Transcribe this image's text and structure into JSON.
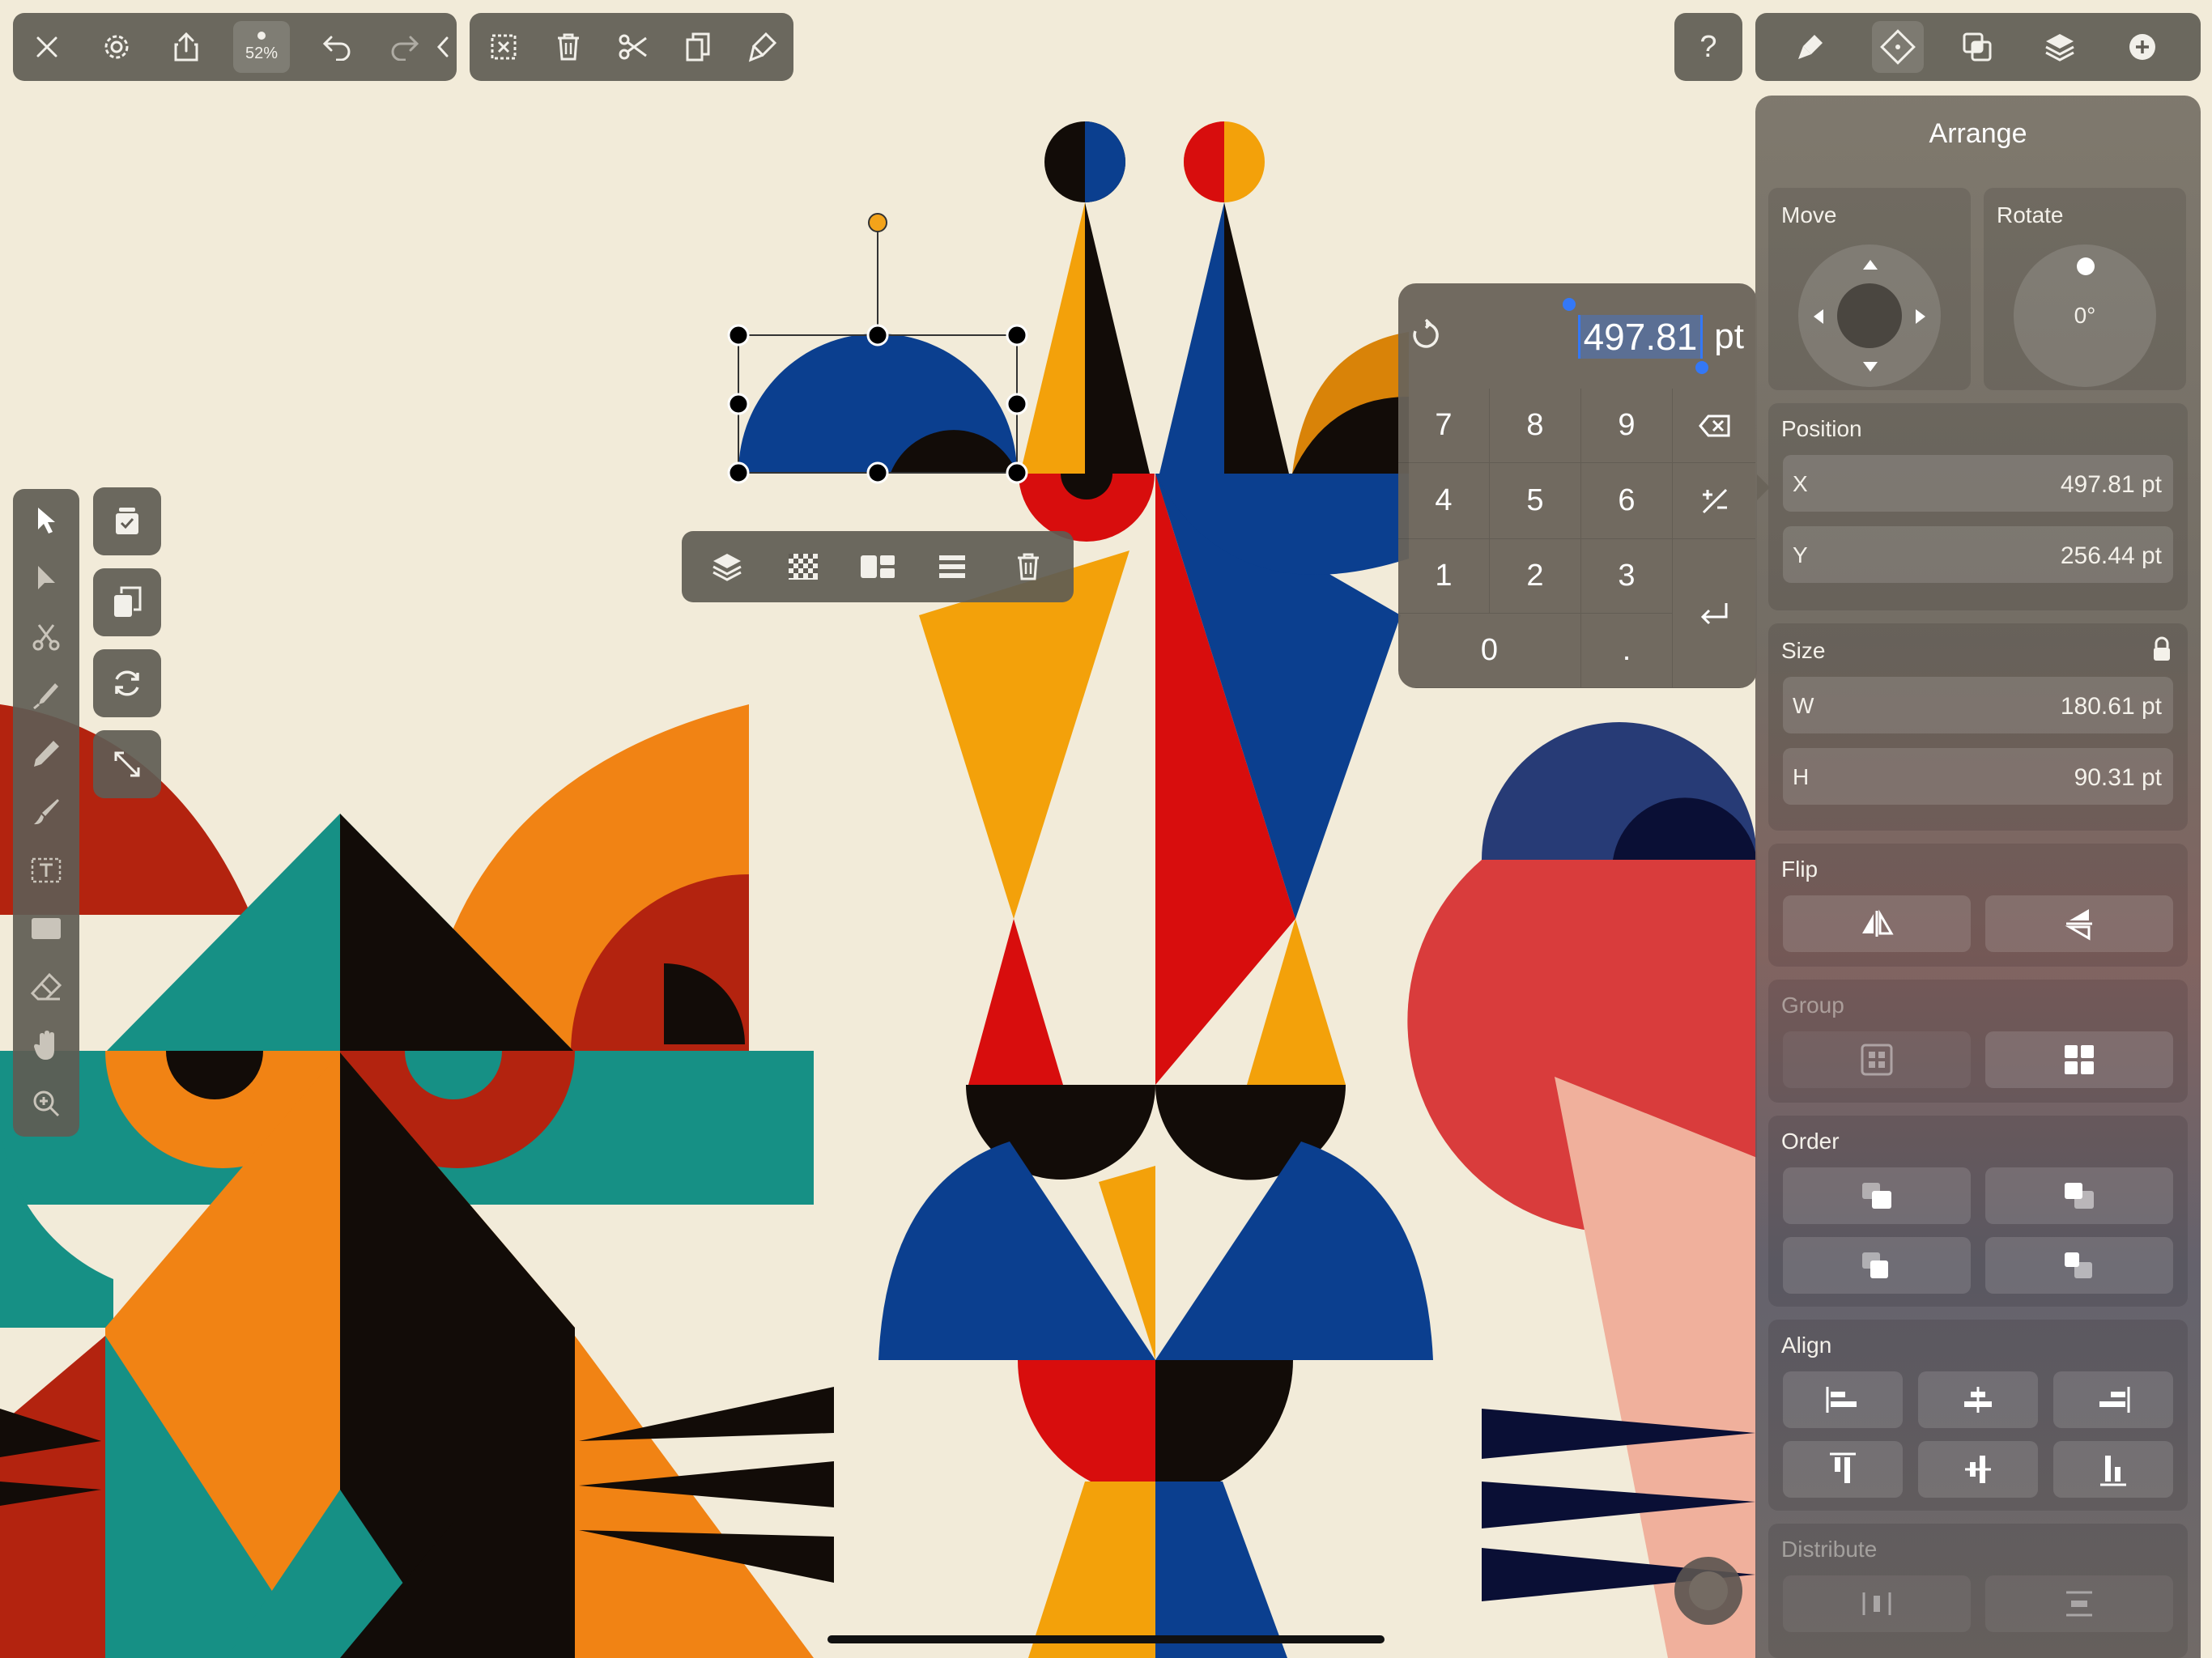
{
  "top_toolbar": {
    "zoom": "52%"
  },
  "help": {
    "label": "?"
  },
  "keypad": {
    "value": "497.81",
    "unit": "pt",
    "keys": [
      "7",
      "8",
      "9",
      "4",
      "5",
      "6",
      "1",
      "2",
      "3",
      "0",
      "."
    ]
  },
  "arrange": {
    "title": "Arrange",
    "move_label": "Move",
    "rotate_label": "Rotate",
    "rotate_value": "0°",
    "position_label": "Position",
    "x_label": "X",
    "x_value": "497.81 pt",
    "y_label": "Y",
    "y_value": "256.44 pt",
    "size_label": "Size",
    "w_label": "W",
    "w_value": "180.61 pt",
    "h_label": "H",
    "h_value": "90.31 pt",
    "flip_label": "Flip",
    "group_label": "Group",
    "order_label": "Order",
    "align_label": "Align",
    "distribute_label": "Distribute"
  },
  "icons": {
    "top_left": [
      "close-icon",
      "settings-icon",
      "share-icon",
      "undo-icon",
      "redo-icon",
      "collapse-icon"
    ],
    "edit": [
      "select-all-icon",
      "trash-icon",
      "scissors-icon",
      "copy-icon",
      "paste-style-icon"
    ],
    "tabs": [
      "style-icon",
      "arrange-icon",
      "path-ops-icon",
      "layers-icon",
      "add-icon"
    ],
    "tools": [
      "select-tool-icon",
      "direct-select-tool-icon",
      "scissor-tool-icon",
      "pen-tool-icon",
      "pencil-tool-icon",
      "brush-tool-icon",
      "text-tool-icon",
      "rectangle-tool-icon",
      "eraser-tool-icon",
      "hand-tool-icon",
      "zoom-tool-icon"
    ],
    "context": [
      "arrange-layer-icon",
      "opacity-icon",
      "repeat-icon",
      "align-menu-icon",
      "delete-icon"
    ]
  },
  "colors": {
    "canvas": "#f2ebd9",
    "accent_blue": "#3478f6",
    "selection_handle": "#000000",
    "rotate_handle": "#f3a31a"
  }
}
